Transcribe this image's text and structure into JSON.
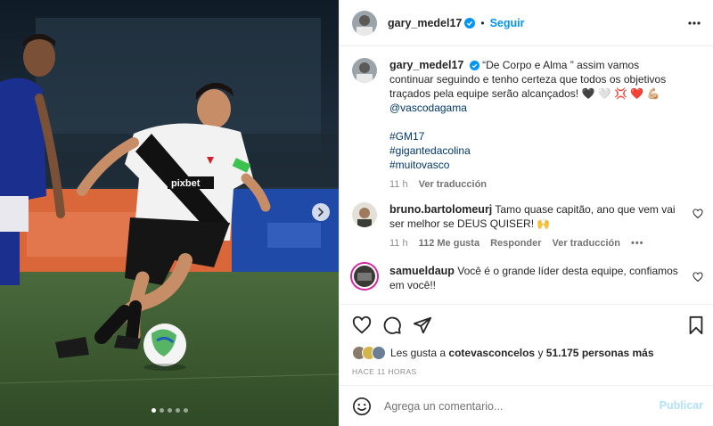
{
  "post": {
    "author": "gary_medel17",
    "follow_label": "Seguir",
    "more_icon": "more-horizontal-icon"
  },
  "caption": {
    "author": "gary_medel17",
    "text": "“De Corpo e Alma ” assim vamos continuar seguindo e tenho certeza que todos os objetivos traçados pela equipe serão alcançados! 🖤 🤍 💢 ❤️ 💪🏼",
    "mention": "@vascodagama",
    "hashtags": [
      "#GM17",
      "#gigantedacolina",
      "#muitovasco"
    ],
    "time": "11 h",
    "translate_label": "Ver traducción"
  },
  "comments": [
    {
      "user": "bruno.bartolomeurj",
      "text": "Tamo quase capitão, ano que vem vai ser melhor se DEUS QUISER! 🙌",
      "time": "11 h",
      "likes": "112 Me gusta",
      "reply_label": "Responder",
      "translate_label": "Ver traducción"
    },
    {
      "user": "samueldaup",
      "text": "Você é o grande líder desta equipe, confiamos em você!!"
    }
  ],
  "likes": {
    "prefix": "Les gusta a ",
    "user": "cotevasconcelos",
    "middle": " y ",
    "count": "51.175 personas más"
  },
  "timestamp": "HACE 11 HORAS",
  "composer": {
    "placeholder": "Agrega un comentario...",
    "publish_label": "Publicar"
  },
  "carousel": {
    "slides": 5,
    "active": 0
  },
  "colors": {
    "accent": "#0095f6",
    "publish_disabled": "#b2dffc",
    "vasco_red": "#d01f2a"
  }
}
